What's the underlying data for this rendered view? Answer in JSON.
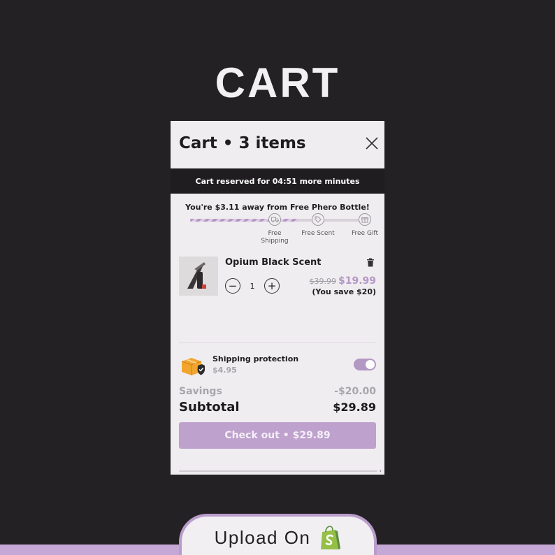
{
  "hero": {
    "title": "CART"
  },
  "cart": {
    "title": "Cart • 3 items",
    "timer_text": "Cart reserved for 04:51 more minutes",
    "reward_text": "You're $3.11 away from Free Phero Bottle!",
    "progress_fraction": 0.62,
    "milestones": [
      {
        "label": "Free\nShipping",
        "icon": "truck-icon"
      },
      {
        "label": "Free Scent",
        "icon": "tag-icon"
      },
      {
        "label": "Free Gift",
        "icon": "gift-icon"
      }
    ],
    "item": {
      "name": "Opium Black Scent",
      "quantity": "1",
      "old_price": "$39.99",
      "new_price": "$19.99",
      "savings_note": "(You save $20)"
    },
    "protection": {
      "title": "Shipping protection",
      "price": "$4.95",
      "enabled": true
    },
    "summary": {
      "savings_label": "Savings",
      "savings_value": "-$20.00",
      "subtotal_label": "Subtotal",
      "subtotal_value": "$29.89"
    },
    "checkout_label": "Check out • $29.89"
  },
  "footer": {
    "upload_text": "Upload On",
    "platform_icon": "shopify-icon"
  },
  "colors": {
    "background": "#232124",
    "accent": "#bea1cd",
    "price_accent": "#b697c6",
    "timer_bar": "#1f1d1f"
  }
}
